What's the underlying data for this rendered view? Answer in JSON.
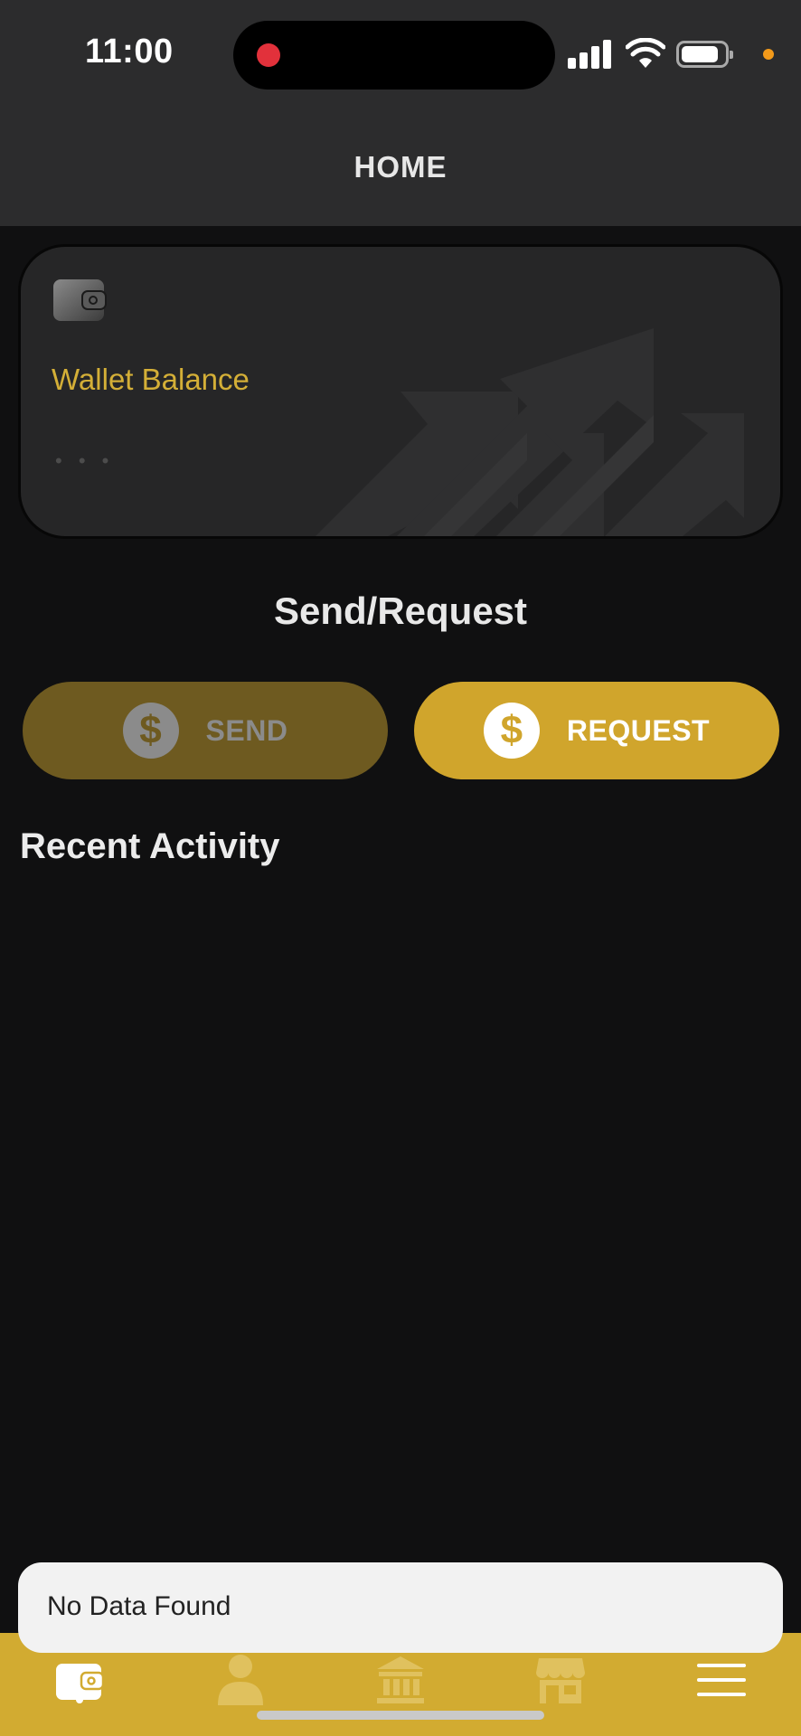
{
  "status_bar": {
    "time": "11:00"
  },
  "header": {
    "title": "HOME"
  },
  "wallet_card": {
    "label": "Wallet Balance",
    "balance_placeholder": "• • •",
    "icon": "wallet-icon"
  },
  "send_request": {
    "title": "Send/Request",
    "send_label": "SEND",
    "request_label": "REQUEST",
    "coin_glyph": "$"
  },
  "recent_activity": {
    "title": "Recent Activity"
  },
  "toast": {
    "message": "No Data Found"
  },
  "bottom_nav": {
    "items": [
      {
        "icon": "wallet-icon",
        "active": true
      },
      {
        "icon": "person-icon",
        "active": false
      },
      {
        "icon": "bank-icon",
        "active": false
      },
      {
        "icon": "store-icon",
        "active": false
      },
      {
        "icon": "menu-icon",
        "active": false
      }
    ]
  },
  "colors": {
    "accent": "#d2ab31",
    "header_bg": "#2c2c2d",
    "page_bg": "#101011",
    "card_bg": "#262627",
    "recording_dot": "#e2313b"
  }
}
